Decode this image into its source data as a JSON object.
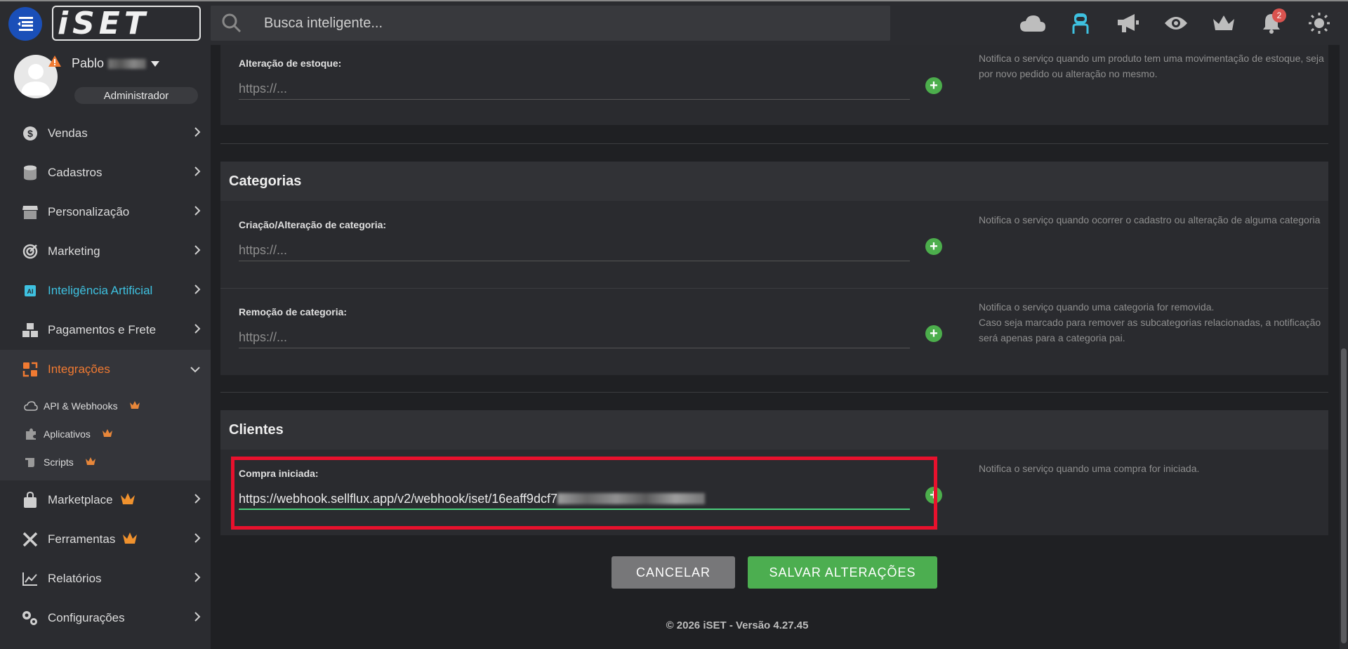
{
  "header": {
    "logo_text": "iSET",
    "search_placeholder": "Busca inteligente...",
    "notification_count": "2"
  },
  "user": {
    "name": "Pablo",
    "role": "Administrador"
  },
  "sidebar": {
    "items": [
      {
        "label": "Vendas"
      },
      {
        "label": "Cadastros"
      },
      {
        "label": "Personalização"
      },
      {
        "label": "Marketing"
      },
      {
        "label": "Inteligência Artificial"
      },
      {
        "label": "Pagamentos e Frete"
      },
      {
        "label": "Integrações"
      },
      {
        "label": "Marketplace"
      },
      {
        "label": "Ferramentas"
      },
      {
        "label": "Relatórios"
      },
      {
        "label": "Configurações"
      }
    ],
    "sub_items": [
      {
        "label": "API & Webhooks"
      },
      {
        "label": "Aplicativos"
      },
      {
        "label": "Scripts"
      }
    ]
  },
  "stock": {
    "label": "Alteração de estoque:",
    "placeholder": "https://...",
    "desc": "Notifica o serviço quando um produto tem uma movimentação de estoque, seja por novo pedido ou alteração no mesmo."
  },
  "categories": {
    "title": "Categorias",
    "create_label": "Criação/Alteração de categoria:",
    "create_placeholder": "https://...",
    "create_desc": "Notifica o serviço quando ocorrer o cadastro ou alteração de alguma categoria",
    "remove_label": "Remoção de categoria:",
    "remove_placeholder": "https://...",
    "remove_desc_1": "Notifica o serviço quando uma categoria for removida.",
    "remove_desc_2": "Caso seja marcado para remover as subcategorias relacionadas, a notificação será apenas para a categoria pai."
  },
  "clients": {
    "title": "Clientes",
    "purchase_label": "Compra iniciada:",
    "purchase_value": "https://webhook.sellflux.app/v2/webhook/iset/16eaff9dcf7",
    "purchase_desc": "Notifica o serviço quando uma compra for iniciada."
  },
  "actions": {
    "cancel": "CANCELAR",
    "save": "SALVAR ALTERAÇÕES"
  },
  "footer": "© 2026 iSET - Versão 4.27.45",
  "colors": {
    "accent_orange": "#f07a32",
    "ai_blue": "#3ec1e0",
    "save_green": "#4cae50",
    "highlight_red": "#e8112d"
  }
}
